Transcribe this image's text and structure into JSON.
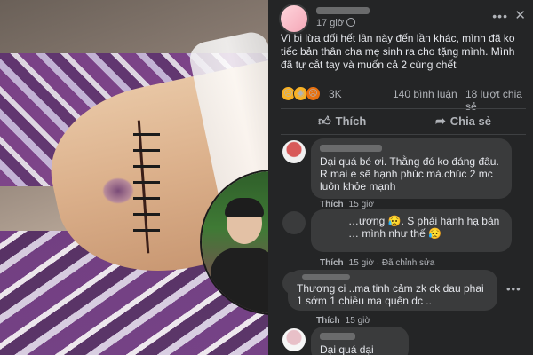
{
  "post": {
    "time": "17 giờ",
    "text": "Vì bị lừa dối hết lần này đến lần khác, mình đã ko tiếc bản thân cha mẹ sinh ra cho tặng mình. Mình đã tự cắt tay và muốn cả 2 cùng chết",
    "reactions": {
      "icons": [
        "sad-icon",
        "wow-icon",
        "angry-icon"
      ],
      "count": "3K"
    },
    "comments_count": "140 bình luận",
    "shares_count": "18 lượt chia sẻ",
    "actions": {
      "like": "Thích",
      "share": "Chia sẻ"
    }
  },
  "comments": [
    {
      "text": "Dại quá bé ơi. Thằng đó ko đáng đâu. R mai e sẽ hạnh phúc mà.chúc 2 mc luôn khỏe mạnh",
      "like": "Thích",
      "time": "15 giờ"
    },
    {
      "text": "…ương 😥. S phải hành hạ bản … mình như thế 😥",
      "like": "Thích",
      "time": "15 giờ",
      "edited": "Đã chỉnh sửa"
    },
    {
      "text": "Thương ci ..ma tinh cảm zk ck dau phai 1 sớm 1 chiều ma quên dc ..",
      "like": "Thích",
      "time": "15 giờ"
    },
    {
      "text": "Dại quá dại"
    }
  ],
  "colors": {
    "panel_bg": "#242526",
    "bubble_bg": "#3a3b3c",
    "text_primary": "#e4e6eb",
    "text_secondary": "#b0b3b8"
  }
}
